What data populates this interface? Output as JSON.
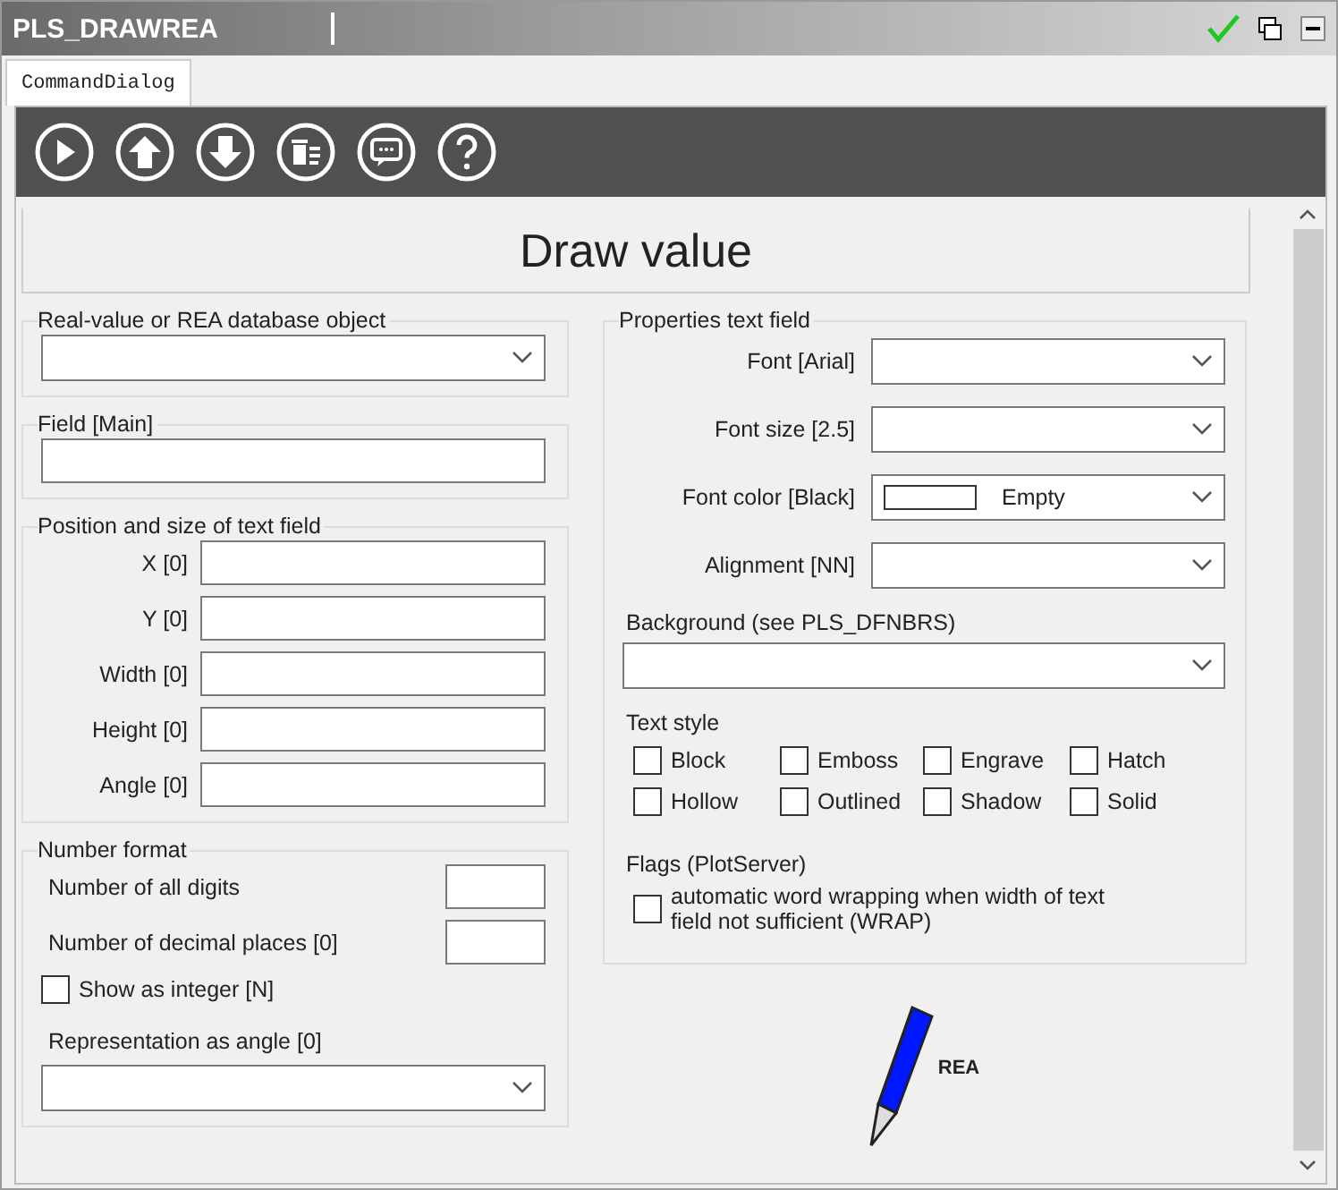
{
  "window": {
    "title": "PLS_DRAWREA"
  },
  "tabs": [
    {
      "label": "CommandDialog",
      "selected": true
    }
  ],
  "heading": "Draw value",
  "database_object": {
    "legend": "Real-value or REA database object"
  },
  "field": {
    "legend": "Field [Main]"
  },
  "position": {
    "legend": "Position and size of text field",
    "rows": [
      "X [0]",
      "Y [0]",
      "Width [0]",
      "Height [0]",
      "Angle [0]"
    ]
  },
  "number_format": {
    "legend": "Number format",
    "digits_label": "Number of all digits",
    "decimals_label": "Number of decimal places [0]",
    "integer_checkbox": {
      "label": "Show as integer [N]",
      "checked": false
    },
    "angle_label": "Representation as angle [0]"
  },
  "properties": {
    "legend": "Properties text field",
    "rows": [
      {
        "kind": "select",
        "label": "Font [Arial]"
      },
      {
        "kind": "select",
        "label": "Font size [2.5]"
      },
      {
        "kind": "color",
        "label": "Font color [Black]",
        "value": "Empty",
        "color": "#ffffff"
      },
      {
        "kind": "select",
        "label": "Alignment [NN]"
      }
    ],
    "background_label": "Background (see PLS_DFNBRS)",
    "text_style": {
      "label": "Text style",
      "options": [
        {
          "label": "Block",
          "checked": false
        },
        {
          "label": "Emboss",
          "checked": false
        },
        {
          "label": "Engrave",
          "checked": false
        },
        {
          "label": "Hatch",
          "checked": false
        },
        {
          "label": "Hollow",
          "checked": false
        },
        {
          "label": "Outlined",
          "checked": false
        },
        {
          "label": "Shadow",
          "checked": false
        },
        {
          "label": "Solid",
          "checked": false
        }
      ]
    },
    "flags": {
      "label": "Flags (PlotServer)",
      "options": [
        {
          "label": "automatic word wrapping when width of text field  not sufficient (WRAP)",
          "checked": false
        }
      ]
    }
  },
  "pen_label": "REA"
}
